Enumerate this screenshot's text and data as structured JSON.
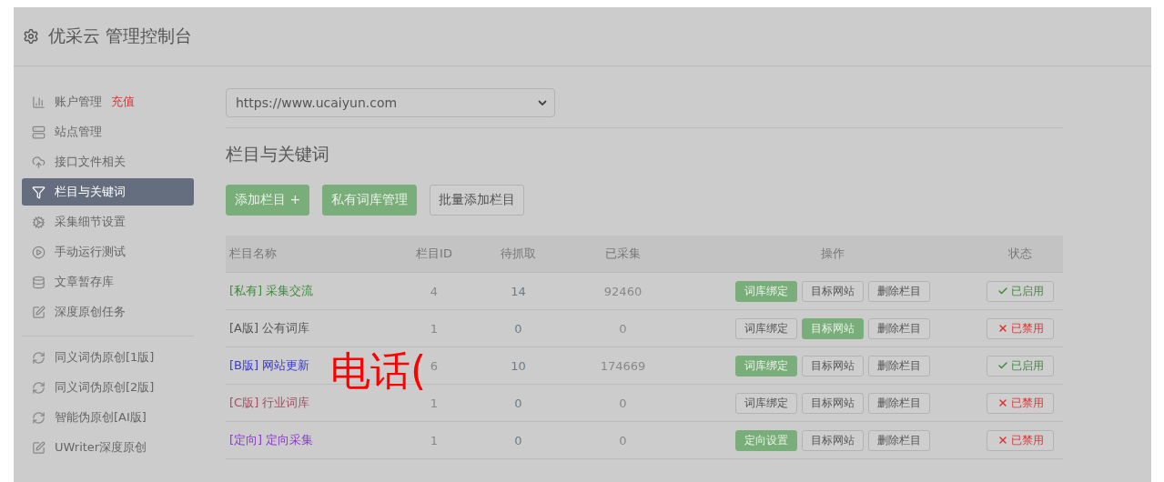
{
  "header": {
    "title": "优采云 管理控制台"
  },
  "sidebar": {
    "items": [
      {
        "label": "账户管理",
        "badge": "充值",
        "selected": false
      },
      {
        "label": "站点管理",
        "selected": false
      },
      {
        "label": "接口文件相关",
        "selected": false
      },
      {
        "label": "栏目与关键词",
        "selected": true
      },
      {
        "label": "采集细节设置",
        "selected": false
      },
      {
        "label": "手动运行测试",
        "selected": false
      },
      {
        "label": "文章暂存库",
        "selected": false
      },
      {
        "label": "深度原创任务",
        "selected": false
      }
    ],
    "tools": [
      {
        "label": "同义词伪原创[1版]",
        "selected": false
      },
      {
        "label": "同义词伪原创[2版]",
        "selected": false
      },
      {
        "label": "智能伪原创[AI版]",
        "selected": false
      },
      {
        "label": "UWriter深度原创",
        "selected": false
      }
    ]
  },
  "site_select": {
    "value": "https://www.ucaiyun.com"
  },
  "heading": "栏目与关键词",
  "toolbar": [
    {
      "label": "添加栏目 +",
      "highlighted": true
    },
    {
      "label": "私有词库管理",
      "highlighted": true
    },
    {
      "label": "批量添加栏目",
      "highlighted": false
    }
  ],
  "table": {
    "columns": [
      "栏目名称",
      "栏目ID",
      "待抓取",
      "已采集",
      "操作",
      "状态"
    ],
    "rows": [
      {
        "tag": "[私有]",
        "name": "采集交流",
        "color": "#3c8a3c",
        "id": "4",
        "pending": "14",
        "collected": "92460",
        "actions": [
          {
            "label": "词库绑定",
            "highlighted": true
          },
          {
            "label": "目标网站",
            "highlighted": false
          },
          {
            "label": "删除栏目",
            "highlighted": false
          }
        ],
        "status": {
          "label": "已启用",
          "enabled": true
        }
      },
      {
        "tag": "[A版]",
        "name": "公有词库",
        "color": "#555555",
        "id": "1",
        "pending": "0",
        "collected": "0",
        "actions": [
          {
            "label": "词库绑定",
            "highlighted": false
          },
          {
            "label": "目标网站",
            "highlighted": true
          },
          {
            "label": "删除栏目",
            "highlighted": false
          }
        ],
        "status": {
          "label": "已禁用",
          "enabled": false
        }
      },
      {
        "tag": "[B版]",
        "name": "网站更新",
        "color": "#3a3ad0",
        "id": "6",
        "pending": "10",
        "collected": "174669",
        "actions": [
          {
            "label": "词库绑定",
            "highlighted": true
          },
          {
            "label": "目标网站",
            "highlighted": false
          },
          {
            "label": "删除栏目",
            "highlighted": false
          }
        ],
        "status": {
          "label": "已启用",
          "enabled": true
        }
      },
      {
        "tag": "[C版]",
        "name": "行业词库",
        "color": "#a05060",
        "id": "1",
        "pending": "0",
        "collected": "0",
        "actions": [
          {
            "label": "词库绑定",
            "highlighted": false
          },
          {
            "label": "目标网站",
            "highlighted": false
          },
          {
            "label": "删除栏目",
            "highlighted": false
          }
        ],
        "status": {
          "label": "已禁用",
          "enabled": false
        }
      },
      {
        "tag": "[定向]",
        "name": "定向采集",
        "color": "#8a3ad0",
        "id": "1",
        "pending": "0",
        "collected": "0",
        "actions": [
          {
            "label": "定向设置",
            "highlighted": true
          },
          {
            "label": "目标网站",
            "highlighted": false
          },
          {
            "label": "删除栏目",
            "highlighted": false
          }
        ],
        "status": {
          "label": "已禁用",
          "enabled": false
        }
      }
    ]
  },
  "overlay_text": "电话("
}
